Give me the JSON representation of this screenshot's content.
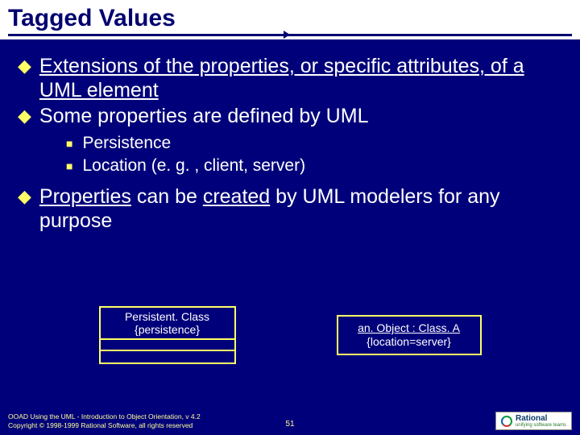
{
  "title": "Tagged Values",
  "bullets": [
    {
      "pre": "",
      "u1": "Extensions of the properties, or specific attributes, of a UML element",
      "post": ""
    },
    {
      "pre": "Some properties are defined by UML",
      "u1": "",
      "post": ""
    }
  ],
  "subs": [
    "Persistence",
    "Location (e. g. , client, server)"
  ],
  "bullet3": {
    "a": "Properties",
    "b": " can be ",
    "c": "created",
    "d": " by UML modelers for any purpose"
  },
  "classbox": {
    "name": "Persistent. Class",
    "tag": "{persistence}"
  },
  "objectbox": {
    "name_u": "an. Object : Class. A",
    "tag": "{location=server}"
  },
  "footer": {
    "line1": "OOAD Using the UML - Introduction to Object Orientation, v 4.2",
    "line2": "Copyright © 1998-1999 Rational Software, all rights reserved",
    "page": "51",
    "brand": "Rational",
    "tagline": "unifying software teams"
  }
}
